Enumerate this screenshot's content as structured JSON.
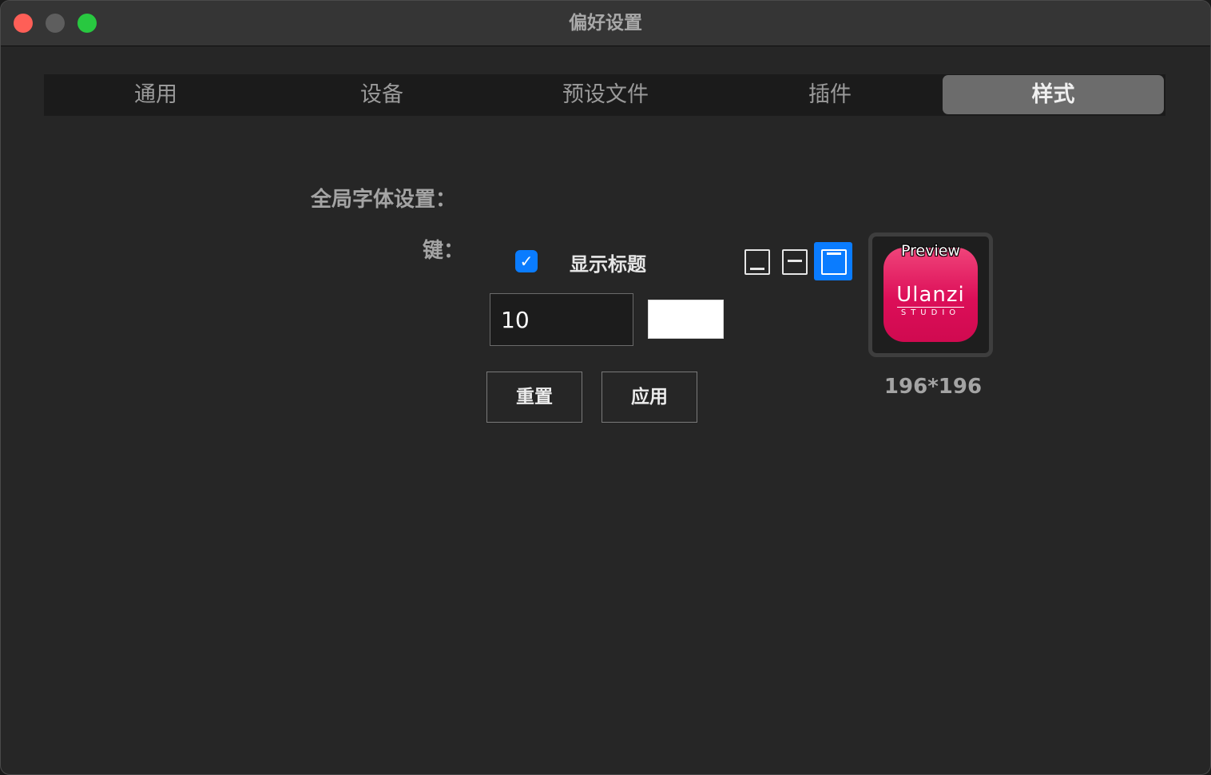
{
  "window": {
    "title": "偏好设置"
  },
  "tabs": [
    {
      "label": "通用"
    },
    {
      "label": "设备"
    },
    {
      "label": "预设文件"
    },
    {
      "label": "插件"
    },
    {
      "label": "样式",
      "active": true
    }
  ],
  "style_settings": {
    "section_label": "全局字体设置：",
    "key_label": "键：",
    "show_title": {
      "checked": true,
      "label": "显示标题",
      "check_glyph": "✓"
    },
    "title_position": {
      "options": [
        "bottom-icon",
        "middle-icon",
        "top-icon"
      ],
      "selected": "top-icon"
    },
    "font_size": "10",
    "font_color": "#ffffff",
    "reset_label": "重置",
    "apply_label": "应用"
  },
  "preview": {
    "title": "Preview",
    "brand": "Ulanzi",
    "brand_sub": "STUDIO",
    "size_label": "196*196"
  },
  "colors": {
    "accent": "#0a7cff",
    "icon_gradient_top": "#f0447a",
    "icon_gradient_bottom": "#d00a50",
    "traffic_close": "#fe5f57",
    "traffic_min": "#5e5e5e",
    "traffic_max": "#28c840"
  }
}
